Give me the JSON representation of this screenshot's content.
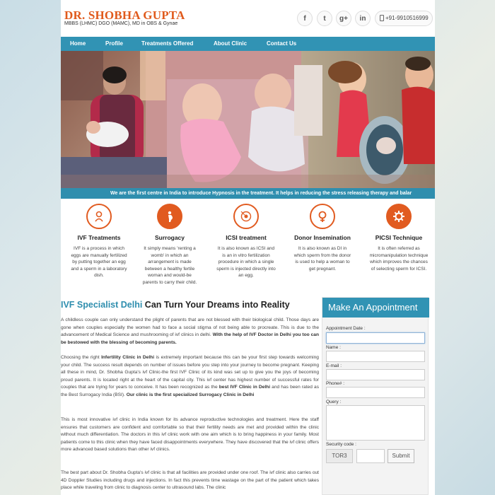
{
  "header": {
    "brand": "DR. SHOBHA GUPTA",
    "subtitle": "MBBS (LHMC) DGO (MAMC), MD in OBS & Gynae",
    "social": [
      "f",
      "t",
      "g+",
      "in"
    ],
    "phone": "+91-9910516999"
  },
  "nav": [
    "Home",
    "Profile",
    "Treatments Offered",
    "About Clinic",
    "Contact Us"
  ],
  "ticker": "We are the first centre in India to introduce Hypnosis in the treatment. It helps in reducing the stress releasing therapy and balar",
  "features": [
    {
      "icon": "baby-icon",
      "title": "IVF Treatments",
      "text": "IVF is a process in which eggs are manually fertilized by putting together an egg and a sperm in a laboratory dish."
    },
    {
      "icon": "pregnancy-icon",
      "title": "Surrogacy",
      "text": "It simply means 'renting a womb' in which an arrangement is made between a healthy fertile woman and would-be parents to carry their child."
    },
    {
      "icon": "egg-icon",
      "title": "ICSI treatment",
      "text": "It is also known as ICSI and is an in vitro fertilization procedure in which a single sperm is injected directly into an egg."
    },
    {
      "icon": "female-symbol-icon",
      "title": "Donor Insemination",
      "text": "It is also known as DI in which sperm from the donor is used to help a woman to get pregnant."
    },
    {
      "icon": "gear-icon",
      "title": "PICSI Technique",
      "text": "It is often referred as micromanipulation technique which improves the chances of selecting sperm for ICSI."
    }
  ],
  "main": {
    "heading_highlight": "IVF Specialist Delhi",
    "heading_rest": " Can Turn Your Dreams into Reality",
    "p1": "A childless couple can only understand the plight of parents that are not blessed with their biological child. Those days are gone when couples especially the women had to face a social stigma of not being able to procreate. This is due to the advancement of Medical Science and mushrooming of ivf clinics in delhi.",
    "p1_bold": "With the help of IVF Doctor in Delhi you too can be bestowed with the blessing of becoming parents.",
    "p2_a": "Choosing the right",
    "p2_b": "Infertility Clinic in Delhi",
    "p2_c": "is extremely important because this can be your first step towards welcoming your child. The success result depends on number of issues before you step into your journey to become pregnant. Keeping all these in mind, Dr. Shobha Gupta's ivf Clinic-the first IVF Clinic of its kind was set up to give you the joys of becoming proud parents. It is located right at the heart of the capital city. This ivf center has highest number of successful rates for couples that are trying for years to conceive. It has been recognized as the",
    "p2_d": "best IVF Clinic in Delhi",
    "p2_e": "and has been rated as the Best Surrogacy India (BSI).",
    "p2_bold": "Our clinic is the first specialized Surrogacy Clinic in Delhi",
    "p3": "This is most innovative ivf clinic in India known for its advance reproductive technologies and treatment. Here the staff ensures that customers are confident and comfortable so that their fertility needs are met and provided within the clinic without much differentiation. The doctors in this ivf clinic work with one aim which is to bring happiness in your family. Most patients come to this clinic when they have faced disappointments everywhere. They have discovered that the ivf clinic offers more advanced based solutions than other ivf clinics.",
    "p4": "The best part about Dr. Shobha Gupta's ivf clinic is that all facilities are provided under one roof. The ivf clinic also carries out 4D Doppler Studies including drugs and injections. In fact this prevents time wastage on the part of the patient which takes place while traveling from clinic to diagnosis center to ultrasound labs. The clinic"
  },
  "appointment": {
    "title": "Make An Appointment",
    "date_label": "Appointment Date :",
    "name_label": "Name :",
    "email_label": "E-mail :",
    "phone_label": "Phone# :",
    "query_label": "Query :",
    "security_label": "Security code :",
    "captcha": "TOR3",
    "submit": "Submit"
  },
  "colors": {
    "accent": "#3193b4",
    "brand": "#e05a1c"
  }
}
